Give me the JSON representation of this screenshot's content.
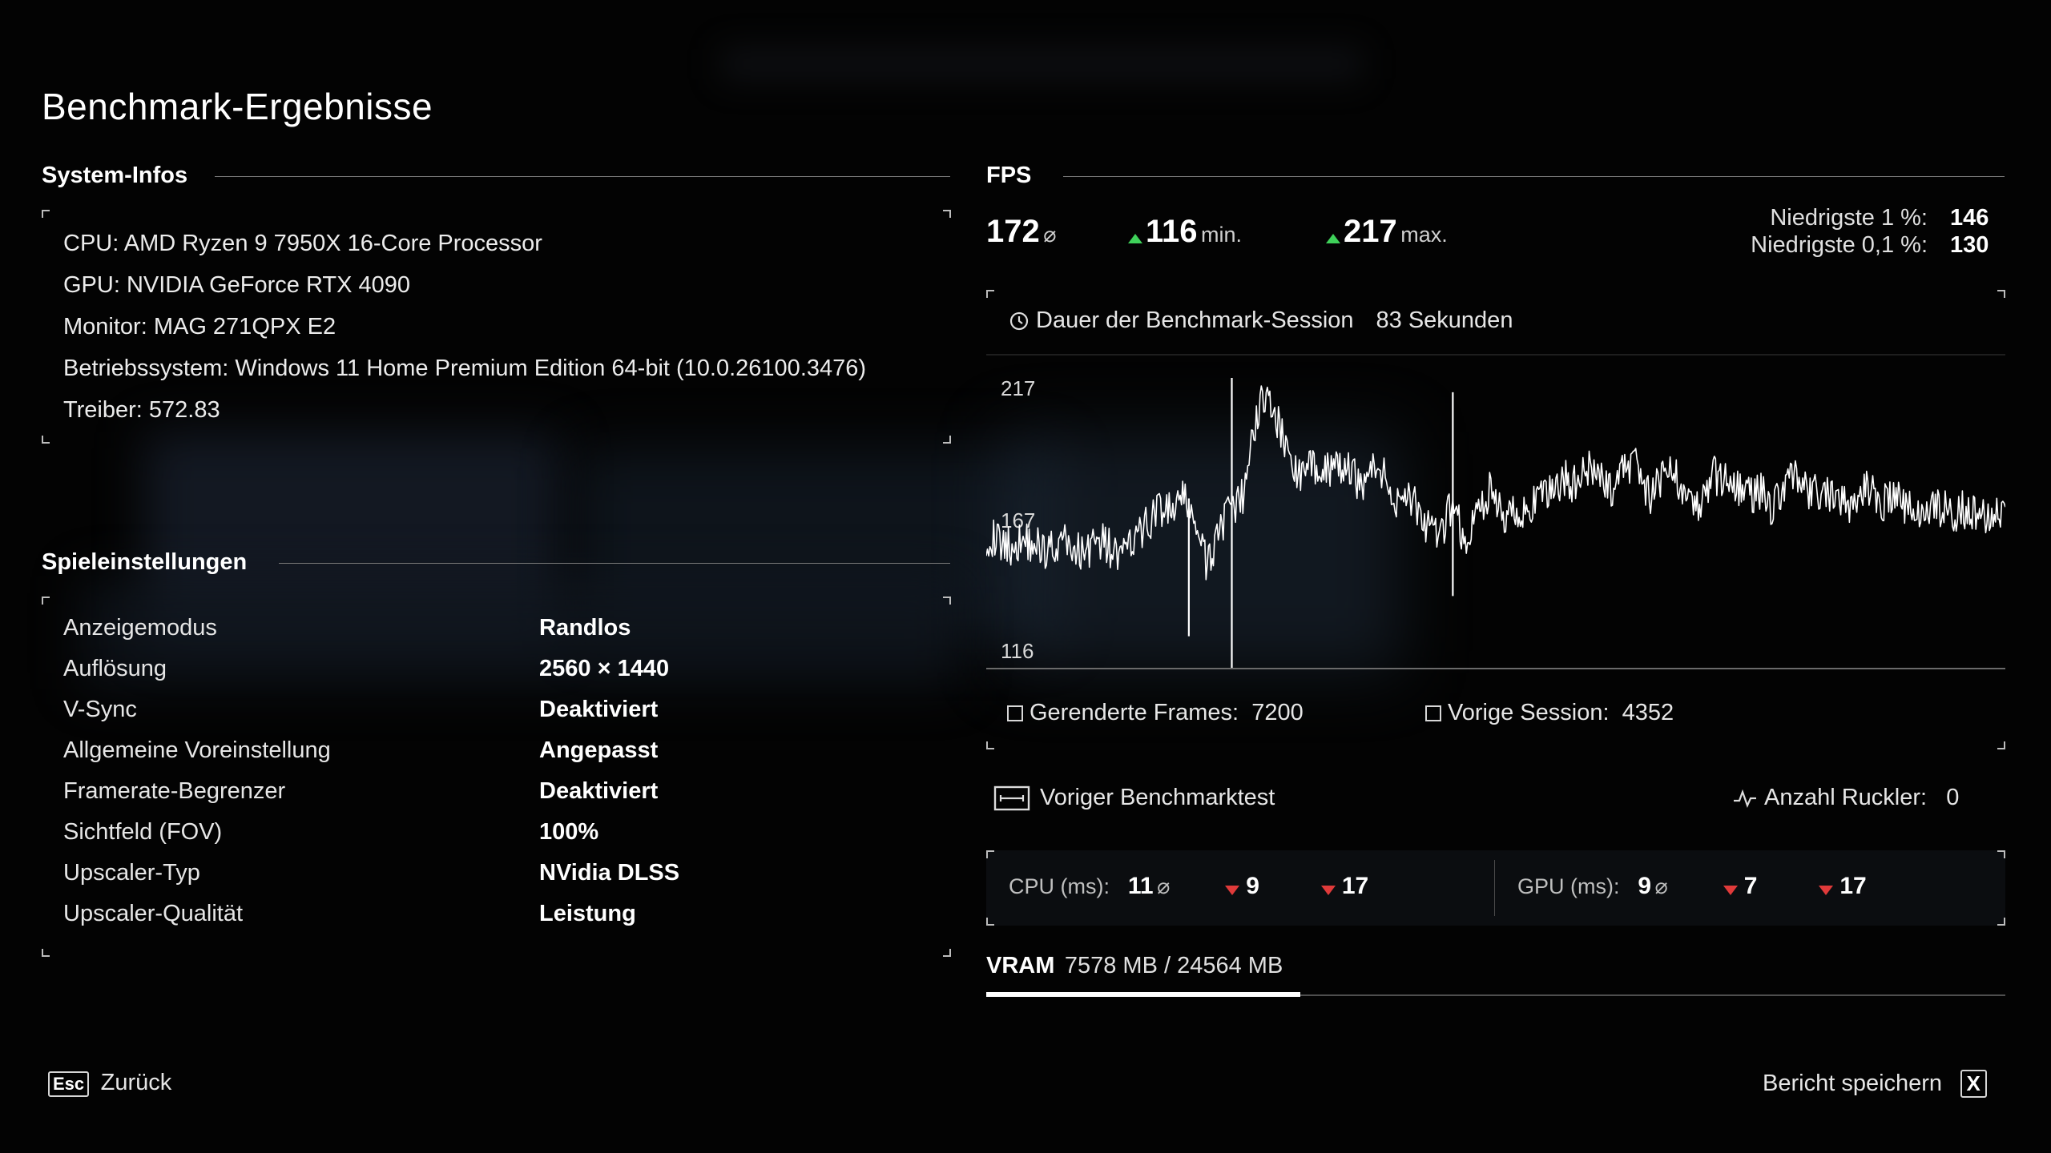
{
  "page_title": "Benchmark-Ergebnisse",
  "system": {
    "heading": "System-Infos",
    "lines": [
      "CPU: AMD Ryzen 9 7950X 16-Core Processor",
      "GPU: NVIDIA GeForce RTX 4090",
      "Monitor: MAG 271QPX E2",
      "Betriebssystem: Windows 11 Home Premium Edition 64-bit (10.0.26100.3476)",
      "Treiber: 572.83"
    ]
  },
  "settings": {
    "heading": "Spieleinstellungen",
    "rows": [
      {
        "label": "Anzeigemodus",
        "value": "Randlos"
      },
      {
        "label": "Auflösung",
        "value": "2560 × 1440"
      },
      {
        "label": "V-Sync",
        "value": "Deaktiviert"
      },
      {
        "label": "Allgemeine Voreinstellung",
        "value": "Angepasst"
      },
      {
        "label": "Framerate-Begrenzer",
        "value": "Deaktiviert"
      },
      {
        "label": "Sichtfeld (FOV)",
        "value": "100%"
      },
      {
        "label": "Upscaler-Typ",
        "value": "NVidia DLSS"
      },
      {
        "label": "Upscaler-Qualität",
        "value": "Leistung"
      }
    ]
  },
  "fps": {
    "heading": "FPS",
    "avg": "172",
    "avg_unit": "⌀",
    "min": "116",
    "min_unit": "min.",
    "max": "217",
    "max_unit": "max.",
    "low1_label": "Niedrigste 1 %:",
    "low1_value": "146",
    "low01_label": "Niedrigste 0,1 %:",
    "low01_value": "130",
    "up_color": "#3fd15a"
  },
  "session": {
    "label": "Dauer der Benchmark-Session",
    "value": "83 Sekunden",
    "rendered_label": "Gerenderte Frames:",
    "rendered_value": "7200",
    "previous_label": "Vorige Session:",
    "previous_value": "4352"
  },
  "chart_data": {
    "type": "line",
    "title": "",
    "xlabel": "",
    "ylabel": "",
    "y_ticks": [
      "217",
      "167",
      "116"
    ],
    "ylim": [
      116,
      217
    ],
    "xlim": [
      0,
      83
    ],
    "series": [
      {
        "x": [
          0,
          1,
          2,
          3,
          4,
          5,
          6,
          7,
          8,
          9,
          10,
          11,
          12,
          13,
          14,
          15,
          16,
          17,
          18,
          19,
          20,
          21,
          22,
          23,
          24,
          25,
          26,
          27,
          28,
          29,
          30,
          31,
          32,
          33,
          34,
          35,
          36,
          37,
          38,
          39,
          40,
          41,
          42,
          43,
          44,
          45,
          46,
          47,
          48,
          49,
          50,
          51,
          52,
          53,
          54,
          55,
          56,
          57,
          58,
          59,
          60,
          61,
          62,
          63,
          64,
          65,
          66,
          67,
          68,
          69,
          70,
          71,
          72,
          73,
          74,
          75,
          76,
          77,
          78,
          79,
          80,
          81,
          82,
          83
        ],
        "values": [
          162,
          160,
          158,
          161,
          159,
          157,
          160,
          158,
          156,
          161,
          158,
          154,
          160,
          165,
          172,
          170,
          175,
          168,
          150,
          166,
          170,
          176,
          205,
          212,
          198,
          185,
          183,
          188,
          184,
          186,
          182,
          181,
          188,
          174,
          178,
          172,
          164,
          160,
          175,
          158,
          170,
          178,
          168,
          172,
          170,
          174,
          178,
          182,
          180,
          185,
          182,
          178,
          186,
          188,
          175,
          182,
          184,
          178,
          170,
          183,
          182,
          180,
          176,
          178,
          172,
          180,
          184,
          175,
          178,
          174,
          172,
          176,
          180,
          174,
          176,
          172,
          170,
          173,
          171,
          170,
          172,
          169,
          171,
          172
        ]
      }
    ],
    "spikes": [
      {
        "x": 16.5,
        "values": [
          127,
          175
        ]
      },
      {
        "x": 20,
        "values": [
          116,
          217
        ]
      },
      {
        "x": 38,
        "values": [
          141,
          212
        ]
      }
    ],
    "color": "#ffffff"
  },
  "previous_test": {
    "label": "Voriger Benchmarktest",
    "stutter_label": "Anzahl Ruckler:",
    "stutter_value": "0"
  },
  "frametimes": {
    "cpu_label": "CPU (ms):",
    "cpu_avg": "11",
    "cpu_min": "9",
    "cpu_max": "17",
    "gpu_label": "GPU (ms):",
    "gpu_avg": "9",
    "gpu_min": "7",
    "gpu_max": "17",
    "avg_unit": "⌀",
    "down_color": "#e03a3a"
  },
  "vram": {
    "label": "VRAM",
    "value": "7578 MB / 24564 MB",
    "used_fraction": 0.3085
  },
  "footer": {
    "back_key": "Esc",
    "back_label": "Zurück",
    "save_label": "Bericht speichern",
    "save_key": "X"
  },
  "icons": {
    "clock": "clock-icon",
    "checkbox": "checkbox-icon",
    "monitor": "monitor-icon",
    "pulse": "pulse-icon"
  }
}
